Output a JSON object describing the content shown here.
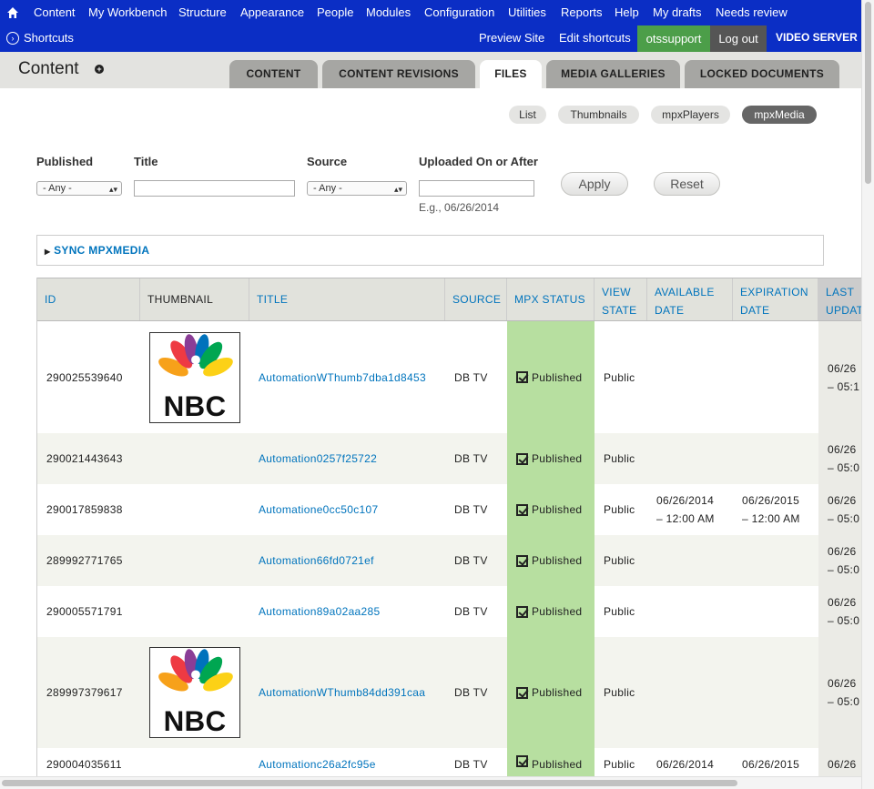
{
  "toolbar": {
    "menu": [
      "Content",
      "My Workbench",
      "Structure",
      "Appearance",
      "People",
      "Modules",
      "Configuration",
      "Utilities",
      "Reports",
      "Help",
      "My drafts",
      "Needs review"
    ],
    "shortcuts_label": "Shortcuts",
    "preview_site": "Preview Site",
    "edit_shortcuts": "Edit shortcuts",
    "user": "otssupport",
    "logout": "Log out",
    "server": "VIDEO SERVER",
    "icons": {
      "home": "home-icon",
      "shortcuts": "chevron-circle-icon"
    }
  },
  "header": {
    "title": "Content",
    "tabs": [
      "CONTENT",
      "CONTENT REVISIONS",
      "FILES",
      "MEDIA GALLERIES",
      "LOCKED DOCUMENTS"
    ],
    "active_tab": "FILES"
  },
  "subtabs": {
    "items": [
      "List",
      "Thumbnails",
      "mpxPlayers",
      "mpxMedia"
    ],
    "active": "mpxMedia"
  },
  "filters": {
    "published_label": "Published",
    "published_value": "- Any -",
    "title_label": "Title",
    "title_value": "",
    "source_label": "Source",
    "source_value": "- Any -",
    "uploaded_label": "Uploaded On or After",
    "uploaded_value": "",
    "uploaded_hint": "E.g., 06/26/2014",
    "apply": "Apply",
    "reset": "Reset"
  },
  "sync": {
    "label": "SYNC MPXMEDIA"
  },
  "table": {
    "headers": {
      "id": "ID",
      "thumbnail": "THUMBNAIL",
      "title": "TITLE",
      "source": "SOURCE",
      "mpx_status": "MPX STATUS",
      "view_state_1": "VIEW",
      "view_state_2": "STATE",
      "available_1": "AVAILABLE",
      "available_2": "DATE",
      "expiration_1": "EXPIRATION",
      "expiration_2": "DATE",
      "last_1": "LAST",
      "last_2": "UPDAT"
    },
    "rows": [
      {
        "id": "290025539640",
        "thumb": "NBC",
        "title": "AutomationWThumb7dba1d8453",
        "source": "DB TV",
        "status": "Published",
        "view": "Public",
        "available_1": "",
        "available_2": "",
        "expiration_1": "",
        "expiration_2": "",
        "last_1": "06/26",
        "last_2": "– 05:1"
      },
      {
        "id": "290021443643",
        "thumb": "",
        "title": "Automation0257f25722",
        "source": "DB TV",
        "status": "Published",
        "view": "Public",
        "available_1": "",
        "available_2": "",
        "expiration_1": "",
        "expiration_2": "",
        "last_1": "06/26",
        "last_2": "– 05:0"
      },
      {
        "id": "290017859838",
        "thumb": "",
        "title": "Automatione0cc50c107",
        "source": "DB TV",
        "status": "Published",
        "view": "Public",
        "available_1": "06/26/2014",
        "available_2": "– 12:00 AM",
        "expiration_1": "06/26/2015",
        "expiration_2": "– 12:00 AM",
        "last_1": "06/26",
        "last_2": "– 05:0"
      },
      {
        "id": "289992771765",
        "thumb": "",
        "title": "Automation66fd0721ef",
        "source": "DB TV",
        "status": "Published",
        "view": "Public",
        "available_1": "",
        "available_2": "",
        "expiration_1": "",
        "expiration_2": "",
        "last_1": "06/26",
        "last_2": "– 05:0"
      },
      {
        "id": "290005571791",
        "thumb": "",
        "title": "Automation89a02aa285",
        "source": "DB TV",
        "status": "Published",
        "view": "Public",
        "available_1": "",
        "available_2": "",
        "expiration_1": "",
        "expiration_2": "",
        "last_1": "06/26",
        "last_2": "– 05:0"
      },
      {
        "id": "289997379617",
        "thumb": "NBC",
        "title": "AutomationWThumb84dd391caa",
        "source": "DB TV",
        "status": "Published",
        "view": "Public",
        "available_1": "",
        "available_2": "",
        "expiration_1": "",
        "expiration_2": "",
        "last_1": "06/26",
        "last_2": "– 05:0"
      },
      {
        "id": "290004035611",
        "thumb": "",
        "title": "Automationc26a2fc95e",
        "source": "DB TV",
        "status": "Published",
        "view": "Public",
        "available_1": "06/26/2014",
        "available_2": "",
        "expiration_1": "06/26/2015",
        "expiration_2": "",
        "last_1": "06/26",
        "last_2": ""
      }
    ]
  },
  "colors": {
    "toolbar": "#0b2ec5",
    "user_bg": "#4c9e49",
    "link": "#0074bd",
    "status_bg": "#b7dfa0"
  }
}
